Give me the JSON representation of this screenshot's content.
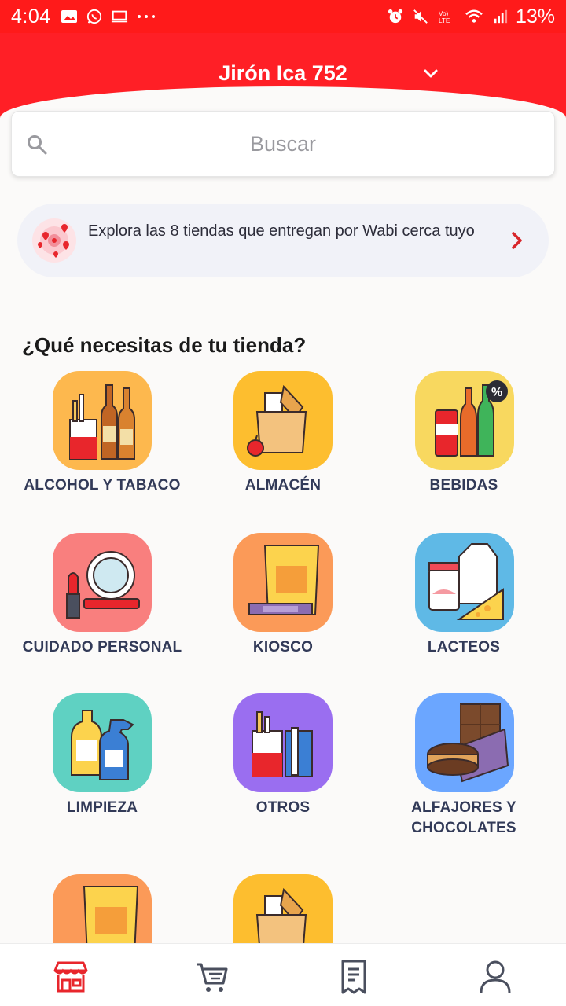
{
  "status_bar": {
    "time": "4:04",
    "battery": "13%",
    "left_icons": [
      "image-icon",
      "whatsapp-icon",
      "laptop-icon",
      "more-dots-icon"
    ],
    "right_icons": [
      "alarm-icon",
      "mute-icon",
      "volte-icon",
      "wifi-icon",
      "signal-icon"
    ]
  },
  "header": {
    "address": "Jirón Ica 752",
    "background": "#ff1f26"
  },
  "search": {
    "placeholder": "Buscar"
  },
  "stores_banner": {
    "text": "Explora las 8 tiendas que entregan por Wabi cerca tuyo"
  },
  "section": {
    "title": "¿Qué necesitas de tu tienda?"
  },
  "categories": [
    {
      "label": "ALCOHOL Y TABACO",
      "icon": "alcohol-tobacco-icon"
    },
    {
      "label": "ALMACÉN",
      "icon": "grocery-bag-icon"
    },
    {
      "label": "BEBIDAS",
      "icon": "drinks-icon"
    },
    {
      "label": "CUIDADO PERSONAL",
      "icon": "personal-care-icon"
    },
    {
      "label": "KIOSCO",
      "icon": "snack-icon"
    },
    {
      "label": "LACTEOS",
      "icon": "dairy-icon"
    },
    {
      "label": "LIMPIEZA",
      "icon": "cleaning-icon"
    },
    {
      "label": "OTROS",
      "icon": "others-icon"
    },
    {
      "label": "ALFAJORES Y CHOCOLATES",
      "icon": "chocolate-icon"
    },
    {
      "label": "",
      "icon": "snack-icon"
    },
    {
      "label": "",
      "icon": "grocery-bag-icon"
    }
  ],
  "bottom_nav": {
    "items": [
      "store-icon",
      "cart-icon",
      "orders-icon",
      "profile-icon"
    ],
    "active": "store-icon",
    "active_color": "#e8262c",
    "inactive_color": "#4a4f5e"
  }
}
